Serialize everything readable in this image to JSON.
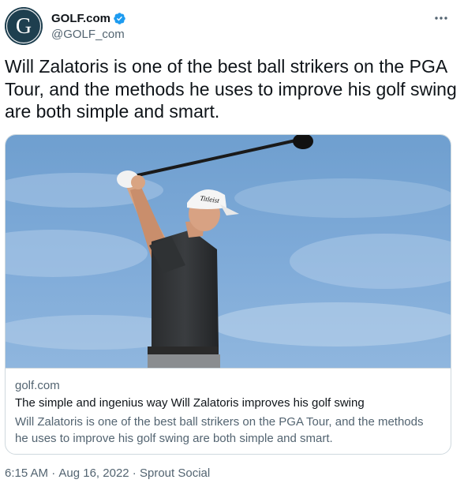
{
  "author": {
    "display_name": "GOLF.com",
    "handle": "@GOLF_com",
    "avatar_letter": "G",
    "verified": true,
    "verified_icon": "verified-badge-icon"
  },
  "tweet": {
    "text": "Will Zalatoris is one of the best ball strikers on the PGA Tour, and the methods he uses to improve his golf swing are both simple and smart."
  },
  "card": {
    "domain": "golf.com",
    "title": "The simple and ingenius way Will Zalatoris improves his golf swing",
    "description": "Will Zalatoris is one of the best ball strikers on the PGA Tour, and the methods he uses to improve his golf swing are both simple and smart.",
    "image_subject": "golfer-swing-photo",
    "cap_logo_text": "Titleist"
  },
  "meta": {
    "time": "6:15 AM",
    "separator": " · ",
    "date": "Aug 16, 2022",
    "source": "Sprout Social"
  },
  "colors": {
    "text_primary": "#0f1419",
    "text_secondary": "#536471",
    "verified_blue": "#1d9bf0",
    "border": "#cfd9de",
    "avatar_bg": "#1e3f4f",
    "sky": "#7aa7d6"
  }
}
